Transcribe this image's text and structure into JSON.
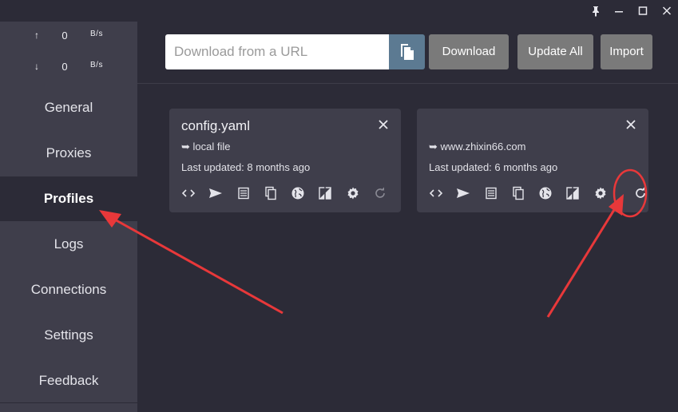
{
  "titlebar": {
    "pin_icon": "pin-icon",
    "minimize_icon": "minimize-icon",
    "maximize_icon": "maximize-icon",
    "close_icon": "close-icon"
  },
  "speed": {
    "upload": {
      "arrow": "↑",
      "value": "0",
      "unit": "B/s"
    },
    "download": {
      "arrow": "↓",
      "value": "0",
      "unit": "B/s"
    }
  },
  "sidebar": {
    "items": [
      {
        "label": "General"
      },
      {
        "label": "Proxies"
      },
      {
        "label": "Profiles"
      },
      {
        "label": "Logs"
      },
      {
        "label": "Connections"
      },
      {
        "label": "Settings"
      },
      {
        "label": "Feedback"
      }
    ],
    "active": "Profiles"
  },
  "toolbar": {
    "url_placeholder": "Download from a URL",
    "url_value": "",
    "download_label": "Download",
    "update_all_label": "Update All",
    "import_label": "Import"
  },
  "profiles": [
    {
      "name": "config.yaml",
      "source": "➥ local file",
      "updated": "Last updated: 8 months ago"
    },
    {
      "name": "",
      "source": "➥ www.zhixin66.com",
      "updated": "Last updated: 6 months ago"
    }
  ],
  "colors": {
    "background": "#2c2b37",
    "sidebar": "#3f3e4b",
    "card": "#3f3e4b",
    "paste_button": "#5c7a92",
    "toolbar_button": "#7a7a7a",
    "annotation": "#e8383a"
  }
}
